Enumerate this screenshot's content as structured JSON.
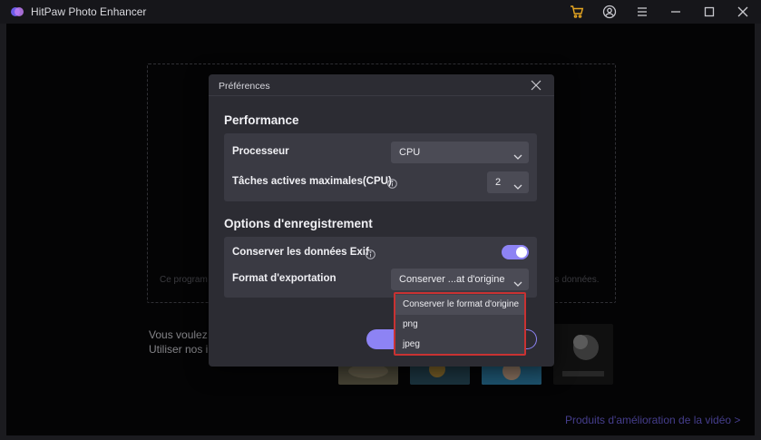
{
  "app": {
    "title": "HitPaw Photo Enhancer"
  },
  "main": {
    "dropzone_hint_left": "Ce program",
    "dropzone_hint_right": "os données.",
    "try_line1": "Vous voulez e",
    "try_line2": "Utiliser nos in",
    "video_link": "Produits d'amélioration de la vidéo  >"
  },
  "dialog": {
    "title": "Préférences",
    "performance": {
      "heading": "Performance",
      "processor_label": "Processeur",
      "processor_value": "CPU",
      "max_tasks_label": "Tâches actives maximales(CPU)",
      "max_tasks_value": "2"
    },
    "save_options": {
      "heading": "Options d'enregistrement",
      "exif_label": "Conserver les données Exif",
      "exif_enabled": true,
      "format_label": "Format d'exportation",
      "format_value": "Conserver ...at d'origine"
    },
    "format_options": [
      "Conserver le format d'origine",
      "png",
      "jpeg"
    ]
  },
  "colors": {
    "accent": "#8d83f4",
    "highlight_border": "#c93232",
    "link": "#6a5fd8"
  }
}
